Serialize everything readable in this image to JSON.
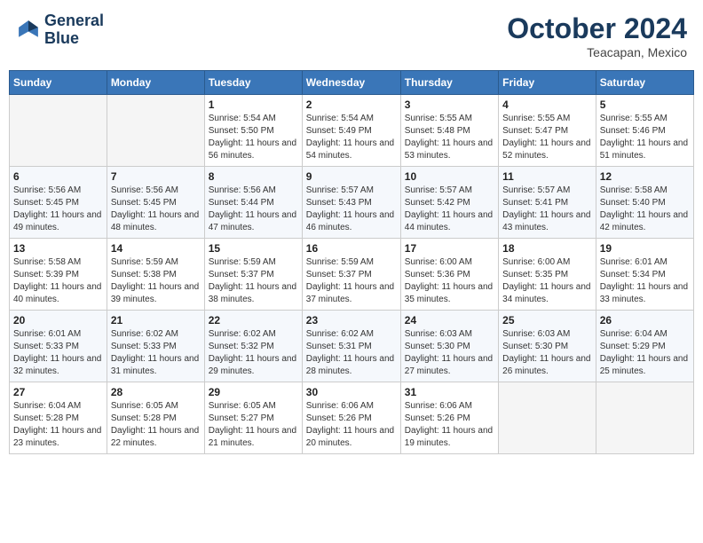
{
  "header": {
    "logo_line1": "General",
    "logo_line2": "Blue",
    "month": "October 2024",
    "location": "Teacapan, Mexico"
  },
  "weekdays": [
    "Sunday",
    "Monday",
    "Tuesday",
    "Wednesday",
    "Thursday",
    "Friday",
    "Saturday"
  ],
  "weeks": [
    [
      {
        "day": "",
        "sunrise": "",
        "sunset": "",
        "daylight": ""
      },
      {
        "day": "",
        "sunrise": "",
        "sunset": "",
        "daylight": ""
      },
      {
        "day": "1",
        "sunrise": "Sunrise: 5:54 AM",
        "sunset": "Sunset: 5:50 PM",
        "daylight": "Daylight: 11 hours and 56 minutes."
      },
      {
        "day": "2",
        "sunrise": "Sunrise: 5:54 AM",
        "sunset": "Sunset: 5:49 PM",
        "daylight": "Daylight: 11 hours and 54 minutes."
      },
      {
        "day": "3",
        "sunrise": "Sunrise: 5:55 AM",
        "sunset": "Sunset: 5:48 PM",
        "daylight": "Daylight: 11 hours and 53 minutes."
      },
      {
        "day": "4",
        "sunrise": "Sunrise: 5:55 AM",
        "sunset": "Sunset: 5:47 PM",
        "daylight": "Daylight: 11 hours and 52 minutes."
      },
      {
        "day": "5",
        "sunrise": "Sunrise: 5:55 AM",
        "sunset": "Sunset: 5:46 PM",
        "daylight": "Daylight: 11 hours and 51 minutes."
      }
    ],
    [
      {
        "day": "6",
        "sunrise": "Sunrise: 5:56 AM",
        "sunset": "Sunset: 5:45 PM",
        "daylight": "Daylight: 11 hours and 49 minutes."
      },
      {
        "day": "7",
        "sunrise": "Sunrise: 5:56 AM",
        "sunset": "Sunset: 5:45 PM",
        "daylight": "Daylight: 11 hours and 48 minutes."
      },
      {
        "day": "8",
        "sunrise": "Sunrise: 5:56 AM",
        "sunset": "Sunset: 5:44 PM",
        "daylight": "Daylight: 11 hours and 47 minutes."
      },
      {
        "day": "9",
        "sunrise": "Sunrise: 5:57 AM",
        "sunset": "Sunset: 5:43 PM",
        "daylight": "Daylight: 11 hours and 46 minutes."
      },
      {
        "day": "10",
        "sunrise": "Sunrise: 5:57 AM",
        "sunset": "Sunset: 5:42 PM",
        "daylight": "Daylight: 11 hours and 44 minutes."
      },
      {
        "day": "11",
        "sunrise": "Sunrise: 5:57 AM",
        "sunset": "Sunset: 5:41 PM",
        "daylight": "Daylight: 11 hours and 43 minutes."
      },
      {
        "day": "12",
        "sunrise": "Sunrise: 5:58 AM",
        "sunset": "Sunset: 5:40 PM",
        "daylight": "Daylight: 11 hours and 42 minutes."
      }
    ],
    [
      {
        "day": "13",
        "sunrise": "Sunrise: 5:58 AM",
        "sunset": "Sunset: 5:39 PM",
        "daylight": "Daylight: 11 hours and 40 minutes."
      },
      {
        "day": "14",
        "sunrise": "Sunrise: 5:59 AM",
        "sunset": "Sunset: 5:38 PM",
        "daylight": "Daylight: 11 hours and 39 minutes."
      },
      {
        "day": "15",
        "sunrise": "Sunrise: 5:59 AM",
        "sunset": "Sunset: 5:37 PM",
        "daylight": "Daylight: 11 hours and 38 minutes."
      },
      {
        "day": "16",
        "sunrise": "Sunrise: 5:59 AM",
        "sunset": "Sunset: 5:37 PM",
        "daylight": "Daylight: 11 hours and 37 minutes."
      },
      {
        "day": "17",
        "sunrise": "Sunrise: 6:00 AM",
        "sunset": "Sunset: 5:36 PM",
        "daylight": "Daylight: 11 hours and 35 minutes."
      },
      {
        "day": "18",
        "sunrise": "Sunrise: 6:00 AM",
        "sunset": "Sunset: 5:35 PM",
        "daylight": "Daylight: 11 hours and 34 minutes."
      },
      {
        "day": "19",
        "sunrise": "Sunrise: 6:01 AM",
        "sunset": "Sunset: 5:34 PM",
        "daylight": "Daylight: 11 hours and 33 minutes."
      }
    ],
    [
      {
        "day": "20",
        "sunrise": "Sunrise: 6:01 AM",
        "sunset": "Sunset: 5:33 PM",
        "daylight": "Daylight: 11 hours and 32 minutes."
      },
      {
        "day": "21",
        "sunrise": "Sunrise: 6:02 AM",
        "sunset": "Sunset: 5:33 PM",
        "daylight": "Daylight: 11 hours and 31 minutes."
      },
      {
        "day": "22",
        "sunrise": "Sunrise: 6:02 AM",
        "sunset": "Sunset: 5:32 PM",
        "daylight": "Daylight: 11 hours and 29 minutes."
      },
      {
        "day": "23",
        "sunrise": "Sunrise: 6:02 AM",
        "sunset": "Sunset: 5:31 PM",
        "daylight": "Daylight: 11 hours and 28 minutes."
      },
      {
        "day": "24",
        "sunrise": "Sunrise: 6:03 AM",
        "sunset": "Sunset: 5:30 PM",
        "daylight": "Daylight: 11 hours and 27 minutes."
      },
      {
        "day": "25",
        "sunrise": "Sunrise: 6:03 AM",
        "sunset": "Sunset: 5:30 PM",
        "daylight": "Daylight: 11 hours and 26 minutes."
      },
      {
        "day": "26",
        "sunrise": "Sunrise: 6:04 AM",
        "sunset": "Sunset: 5:29 PM",
        "daylight": "Daylight: 11 hours and 25 minutes."
      }
    ],
    [
      {
        "day": "27",
        "sunrise": "Sunrise: 6:04 AM",
        "sunset": "Sunset: 5:28 PM",
        "daylight": "Daylight: 11 hours and 23 minutes."
      },
      {
        "day": "28",
        "sunrise": "Sunrise: 6:05 AM",
        "sunset": "Sunset: 5:28 PM",
        "daylight": "Daylight: 11 hours and 22 minutes."
      },
      {
        "day": "29",
        "sunrise": "Sunrise: 6:05 AM",
        "sunset": "Sunset: 5:27 PM",
        "daylight": "Daylight: 11 hours and 21 minutes."
      },
      {
        "day": "30",
        "sunrise": "Sunrise: 6:06 AM",
        "sunset": "Sunset: 5:26 PM",
        "daylight": "Daylight: 11 hours and 20 minutes."
      },
      {
        "day": "31",
        "sunrise": "Sunrise: 6:06 AM",
        "sunset": "Sunset: 5:26 PM",
        "daylight": "Daylight: 11 hours and 19 minutes."
      },
      {
        "day": "",
        "sunrise": "",
        "sunset": "",
        "daylight": ""
      },
      {
        "day": "",
        "sunrise": "",
        "sunset": "",
        "daylight": ""
      }
    ]
  ]
}
